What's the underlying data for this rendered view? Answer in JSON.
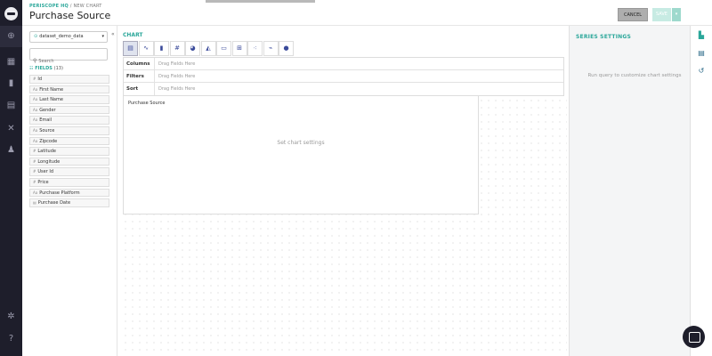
{
  "rail": {
    "icons": [
      "logo-icon",
      "globe-icon",
      "dashboard-icon",
      "bookmark-icon",
      "report-icon",
      "tools-icon",
      "bell-icon",
      "gear-icon",
      "help-icon"
    ]
  },
  "header": {
    "crumb_org": "PERISCOPE HQ",
    "crumb_sep": " / ",
    "crumb_page": "NEW CHART",
    "title": "Purchase Source",
    "cancel_label": "CANCEL",
    "save_label": "SAVE"
  },
  "fields_panel": {
    "dataset": "dataset_demo_data",
    "search_placeholder": "Search",
    "fields_label": "FIELDS",
    "fields_count": "(13)",
    "fields": [
      {
        "type": "#",
        "name": "Id"
      },
      {
        "type": "Aa",
        "name": "First Name"
      },
      {
        "type": "Aa",
        "name": "Last Name"
      },
      {
        "type": "Aa",
        "name": "Gender"
      },
      {
        "type": "Aa",
        "name": "Email"
      },
      {
        "type": "Aa",
        "name": "Source"
      },
      {
        "type": "Aa",
        "name": "Zipcode"
      },
      {
        "type": "#",
        "name": "Latitude"
      },
      {
        "type": "#",
        "name": "Longitude"
      },
      {
        "type": "#",
        "name": "User Id"
      },
      {
        "type": "#",
        "name": "Price"
      },
      {
        "type": "Aa",
        "name": "Purchase Platform"
      },
      {
        "type": "▤",
        "name": "Purchase Date"
      }
    ]
  },
  "chart_panel": {
    "label": "CHART",
    "chart_types": [
      "table-icon",
      "line-icon",
      "bar-icon",
      "number-icon",
      "pie-icon",
      "area-icon",
      "image-icon",
      "pivot-icon",
      "scatter-icon",
      "funnel-icon",
      "bubble-icon"
    ],
    "shelves": [
      {
        "label": "Columns",
        "placeholder": "Drag Fields Here"
      },
      {
        "label": "Filters",
        "placeholder": "Drag Fields Here"
      },
      {
        "label": "Sort",
        "placeholder": "Drag Fields Here"
      }
    ],
    "preview_title": "Purchase Source",
    "preview_placeholder": "Set chart settings"
  },
  "series_settings": {
    "title": "SERIES SETTINGS",
    "message": "Run query to customize chart settings"
  },
  "side_icons": [
    "chart-settings-icon",
    "notes-icon",
    "history-icon"
  ],
  "colors": {
    "accent": "#2ba79a",
    "rail": "#1e1e2b"
  }
}
